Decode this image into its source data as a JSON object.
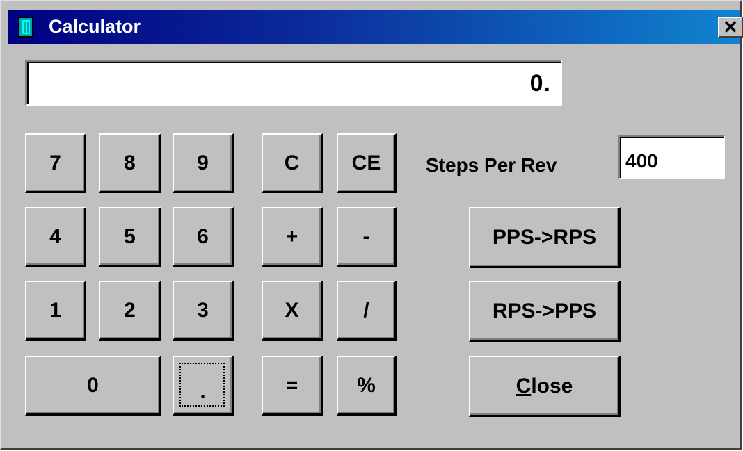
{
  "window": {
    "title": "Calculator",
    "close_glyph": "✕",
    "icon": "calculator-icon"
  },
  "display": {
    "value": "0."
  },
  "keypad": {
    "k7": "7",
    "k8": "8",
    "k9": "9",
    "k4": "4",
    "k5": "5",
    "k6": "6",
    "k1": "1",
    "k2": "2",
    "k3": "3",
    "k0": "0",
    "kdot": "."
  },
  "ops": {
    "clear": "C",
    "clear_entry": "CE",
    "plus": "+",
    "minus": "-",
    "multiply": "X",
    "divide": "/",
    "equals": "=",
    "percent": "%"
  },
  "steps": {
    "label": "Steps Per Rev",
    "value": "400"
  },
  "convert": {
    "pps_to_rps": "PPS->RPS",
    "rps_to_pps": "RPS->PPS"
  },
  "close_button": {
    "accel": "C",
    "rest": "lose"
  }
}
